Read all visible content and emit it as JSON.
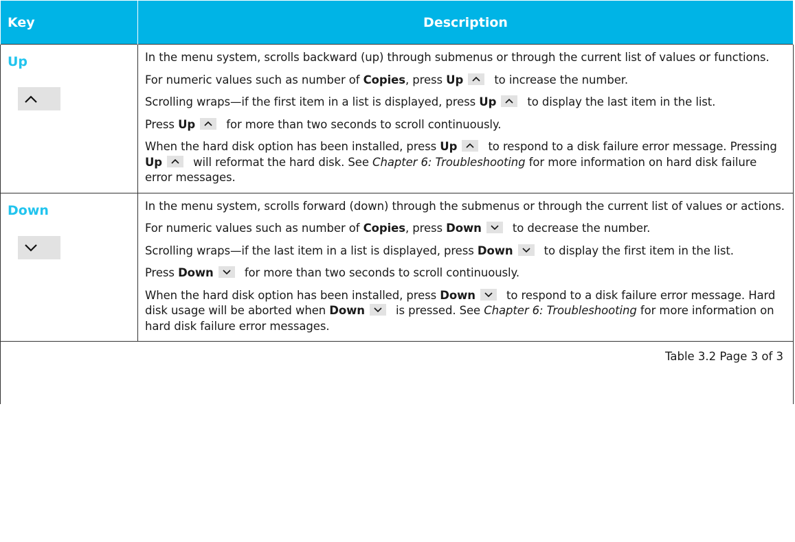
{
  "header": {
    "key": "Key",
    "description": "Description"
  },
  "rows": [
    {
      "key": "Up",
      "paragraphs": [
        "In the menu system, scrolls backward (up) through submenus or through the current list of values or functions.",
        [
          "For numeric values such as number of ",
          "Copies",
          ", press ",
          "Up",
          " to increase the number."
        ],
        [
          "Scrolling wraps—if the first item in a list is displayed, press ",
          "Up",
          " to display the last item in the list."
        ],
        [
          "Press ",
          "Up",
          " for more than two seconds to scroll continuously."
        ],
        [
          "When the hard disk option has been installed, press ",
          "Up",
          " to respond to a disk failure error message. Pressing ",
          "Up",
          " will reformat the hard disk. See ",
          "Chapter 6: Troubleshooting",
          " for more information on hard disk failure error messages."
        ]
      ],
      "icon": "chevron-up-icon"
    },
    {
      "key": "Down",
      "paragraphs": [
        "In the menu system, scrolls forward (down) through the submenus or through the current list of values or actions.",
        [
          "For numeric values such as number of ",
          "Copies",
          ", press ",
          "Down",
          " to decrease the number."
        ],
        [
          "Scrolling wraps—if the last item in a list is displayed, press ",
          "Down",
          " to display the first item in the list."
        ],
        [
          "Press ",
          "Down",
          " for more than two seconds to scroll continuously."
        ],
        [
          "When the hard disk option has been installed, press ",
          "Down",
          " to respond to a disk failure error message. Hard disk usage will be aborted when ",
          "Down",
          " is pressed. See ",
          "Chapter 6: Troubleshooting",
          " for more information on hard disk failure error messages."
        ]
      ],
      "icon": "chevron-down-icon"
    }
  ],
  "footer": "Table 3.2  Page 3 of 3",
  "colors": {
    "header_bg": "#00b4e6",
    "key_text": "#22c4ee",
    "button_bg": "#e2e2e2"
  }
}
